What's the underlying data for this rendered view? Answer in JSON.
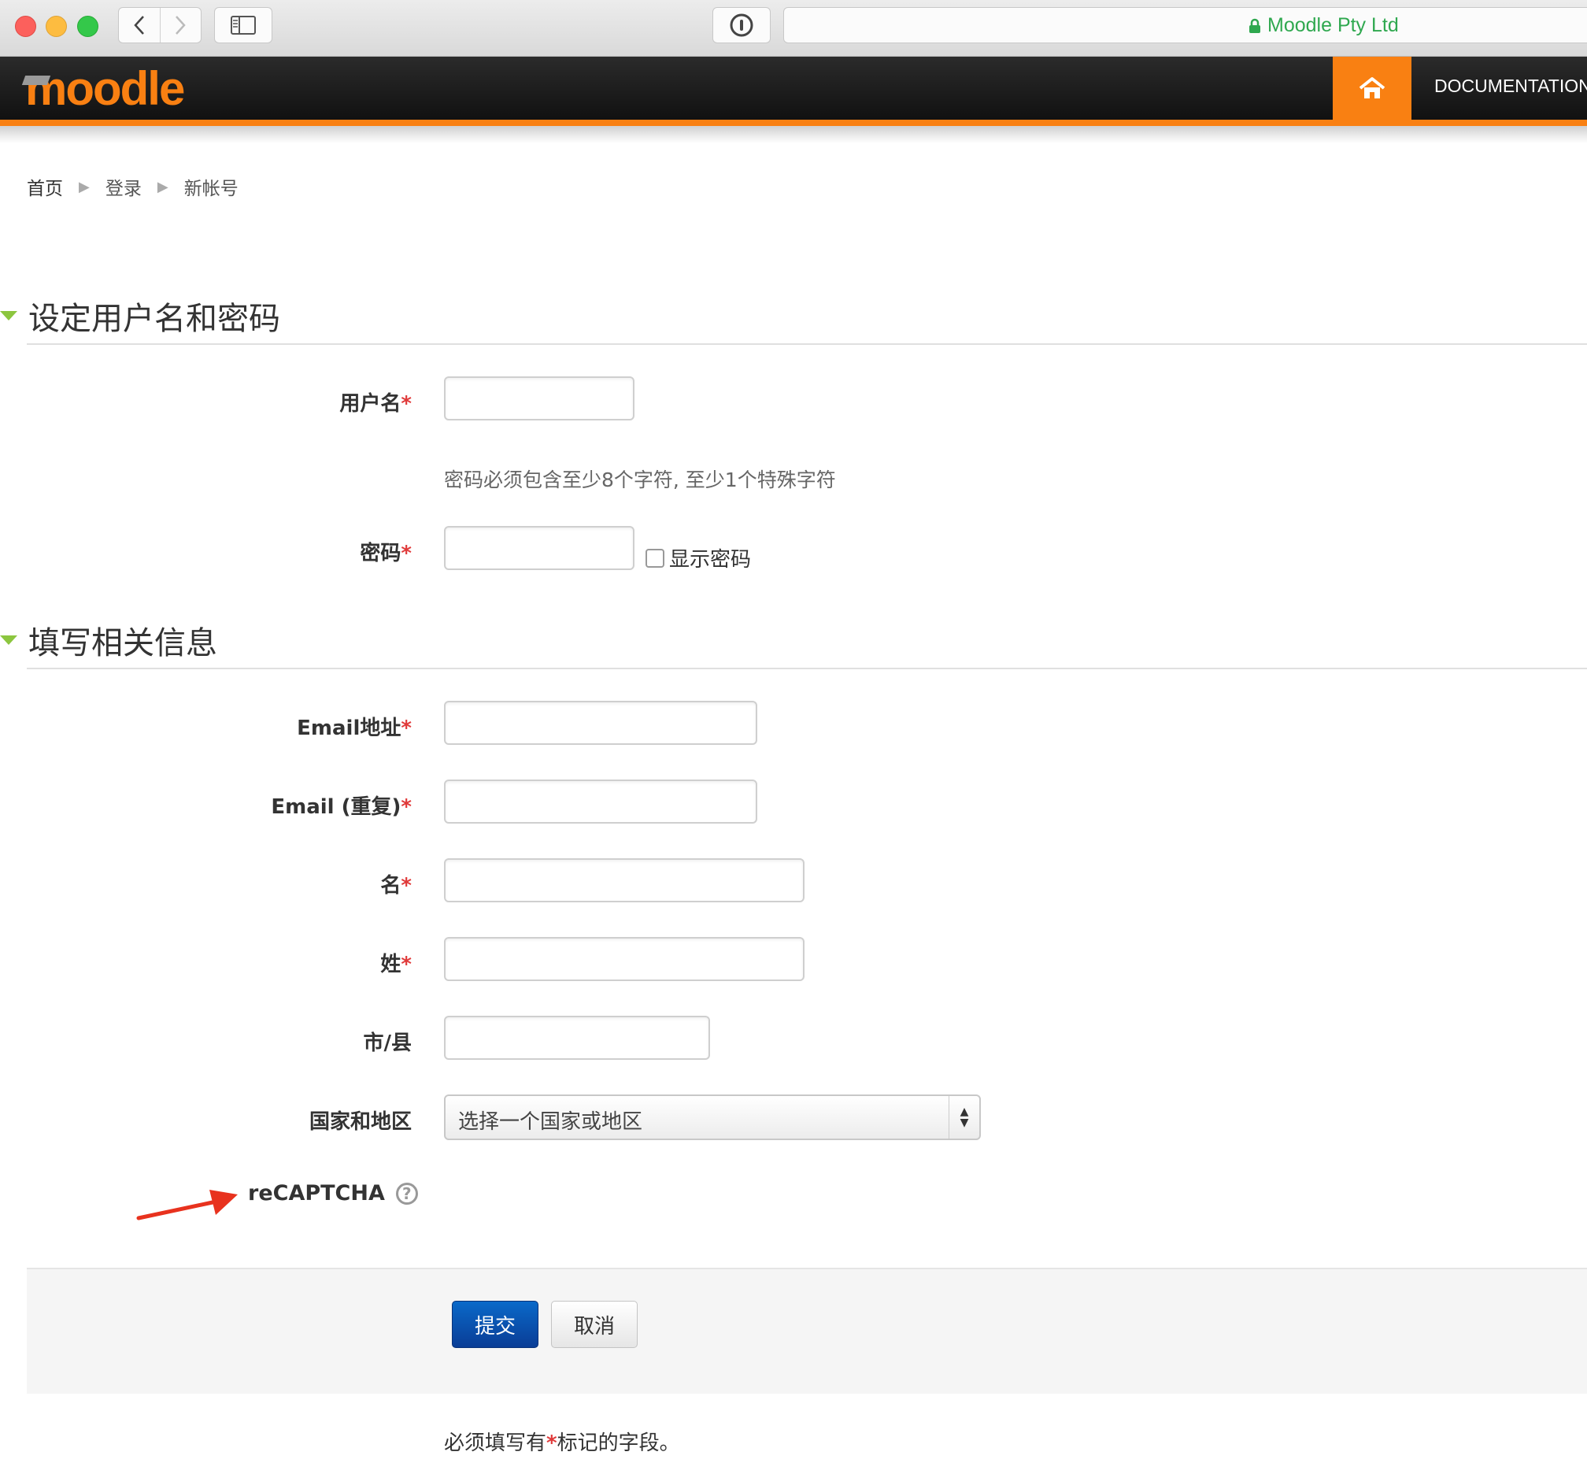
{
  "browser": {
    "url_text": "Moodle Pty Ltd"
  },
  "navbar": {
    "logo_text": "moodle",
    "documentation_label": "DOCUMENTATION"
  },
  "breadcrumb": [
    "首页",
    "登录",
    "新帐号"
  ],
  "section1": {
    "title": "设定用户名和密码",
    "username_label": "用户名",
    "password_hint": "密码必须包含至少8个字符, 至少1个特殊字符",
    "password_label": "密码",
    "show_password_label": "显示密码"
  },
  "section2": {
    "title": "填写相关信息",
    "email_label": "Email地址",
    "email_repeat_label": "Email (重复)",
    "firstname_label": "名",
    "lastname_label": "姓",
    "city_label": "市/县",
    "country_label": "国家和地区",
    "country_value": "选择一个国家或地区",
    "recaptcha_label": "reCAPTCHA"
  },
  "required_mark": "*",
  "actions": {
    "submit_label": "提交",
    "cancel_label": "取消"
  },
  "footnote": {
    "before": "必须填写有",
    "mark": "*",
    "after": "标记的字段。"
  },
  "colors": {
    "accent": "#f98012",
    "required": "#e03a3a",
    "section_toggle": "#8cc63f",
    "primary_button": "#0a4fb0",
    "secure_url": "#2fa84f"
  }
}
